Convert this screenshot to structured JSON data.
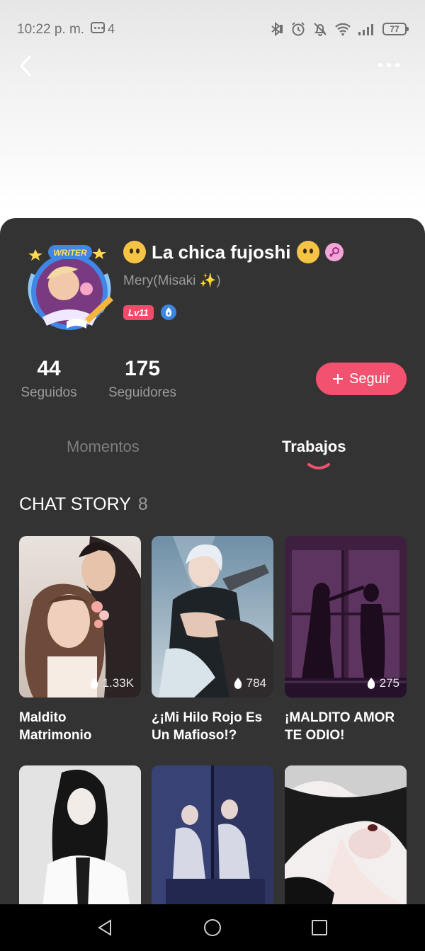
{
  "status": {
    "time": "10:22 p. m.",
    "message_count": "4",
    "battery": "77"
  },
  "header": {
    "back_icon": "chevron-left-icon",
    "more_icon": "more-horizontal-icon"
  },
  "profile": {
    "avatar_badge_text": "WRITER",
    "display_name": "La chica fujoshi",
    "nickname": "Mery(Misaki ✨)",
    "level": "Lv11",
    "gender": "female"
  },
  "stats": {
    "following_count": "44",
    "following_label": "Seguidos",
    "followers_count": "175",
    "followers_label": "Seguidores"
  },
  "follow_button": {
    "label": "Seguir"
  },
  "tabs": [
    {
      "label": "Momentos",
      "active": false
    },
    {
      "label": "Trabajos",
      "active": true
    }
  ],
  "section": {
    "title": "CHAT STORY",
    "count": "8"
  },
  "stories": [
    {
      "title": "Maldito Matrimonio",
      "views": "1.33K"
    },
    {
      "title": "¿¡Mi Hilo Rojo Es Un Mafioso!?",
      "views": "784"
    },
    {
      "title": "¡MALDITO AMOR TE ODIO!",
      "views": "275"
    },
    {
      "title": "",
      "views": ""
    },
    {
      "title": "",
      "views": ""
    },
    {
      "title": "",
      "views": ""
    }
  ],
  "colors": {
    "accent": "#f2516f",
    "sheet_bg": "#333333",
    "level_badge": "#f24b6a"
  }
}
